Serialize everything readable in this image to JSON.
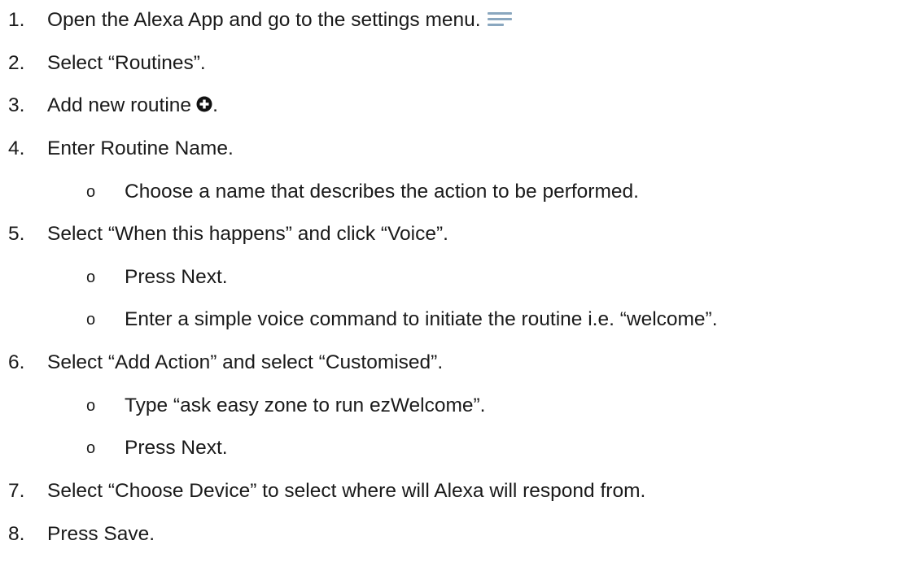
{
  "steps": [
    {
      "number": "1.",
      "text": "Open the Alexa App and go to the settings menu.",
      "icon": "menu-icon"
    },
    {
      "number": "2.",
      "text": "Select “Routines”."
    },
    {
      "number": "3.",
      "text_before": "Add new routine",
      "icon": "plus-circle-icon",
      "text_after": "."
    },
    {
      "number": "4.",
      "text": "Enter Routine Name.",
      "subs": [
        "Choose a name that describes the action to be performed."
      ]
    },
    {
      "number": "5.",
      "text": "Select “When this happens” and click “Voice”.",
      "subs": [
        "Press Next.",
        "Enter a simple voice command to initiate the routine i.e. “welcome”."
      ]
    },
    {
      "number": "6.",
      "text": "Select “Add Action” and select “Customised”.",
      "subs": [
        "Type “ask easy zone to run ezWelcome”.",
        "Press Next."
      ]
    },
    {
      "number": "7.",
      "text": "Select “Choose Device” to select where will Alexa will respond from."
    },
    {
      "number": "8.",
      "text": "Press Save."
    }
  ],
  "bullet_glyph": "o",
  "colors": {
    "text": "#1a1a1a",
    "menu_icon": "#8aa7bf",
    "plus_icon": "#111111"
  }
}
